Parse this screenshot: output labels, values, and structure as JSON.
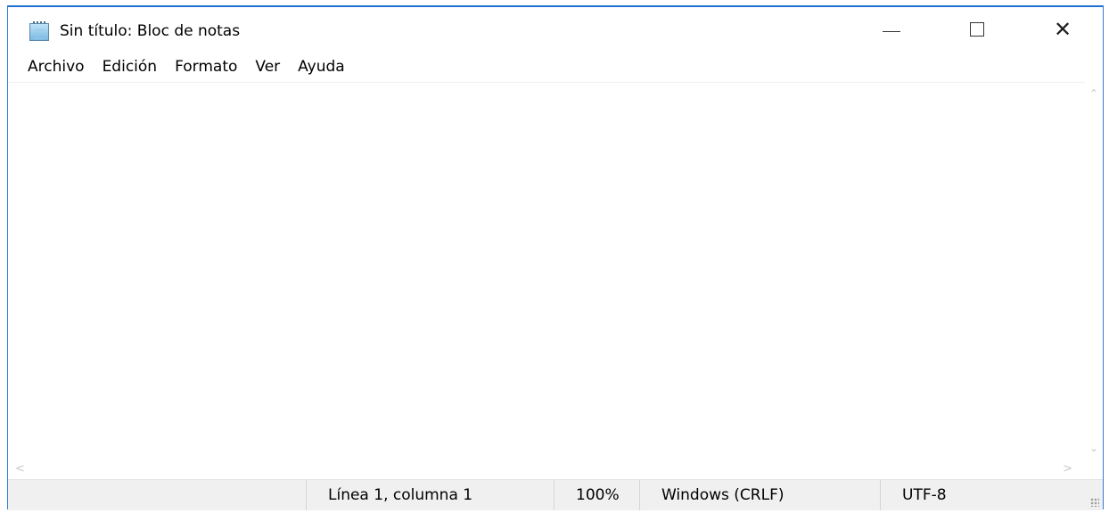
{
  "window": {
    "title": "Sin título: Bloc de notas",
    "controls": {
      "minimize_icon": "minimize-icon",
      "maximize_icon": "maximize-icon",
      "close_icon": "close-icon",
      "close_glyph": "✕"
    }
  },
  "menu": {
    "items": [
      "Archivo",
      "Edición",
      "Formato",
      "Ver",
      "Ayuda"
    ]
  },
  "editor": {
    "content": ""
  },
  "scrollbars": {
    "up": "⌃",
    "down": "⌄",
    "left": "<",
    "right": ">"
  },
  "status": {
    "position": "Línea 1, columna 1",
    "zoom": "100%",
    "line_endings": "Windows (CRLF)",
    "encoding": "UTF-8"
  },
  "colors": {
    "accent_border": "#2f7dd6",
    "statusbar_bg": "#f0f0f0"
  }
}
